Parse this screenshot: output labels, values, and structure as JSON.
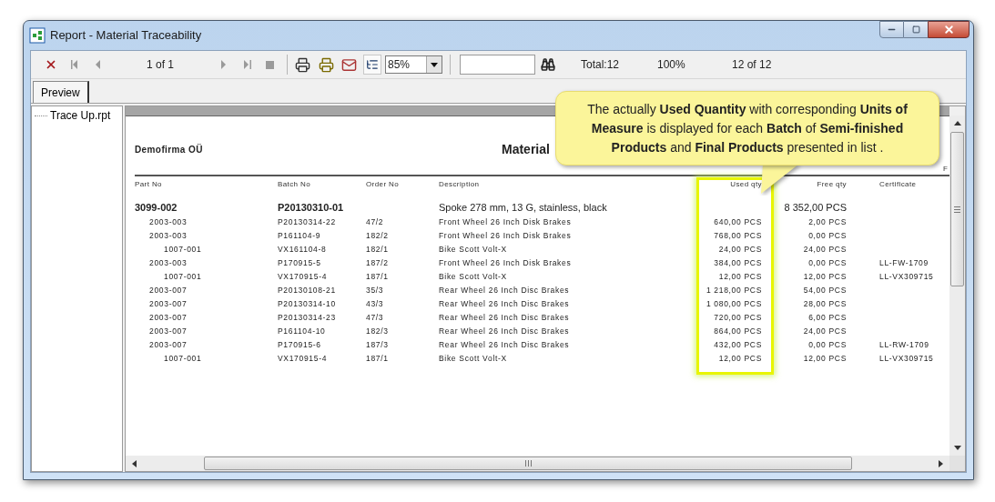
{
  "window": {
    "title": "Report - Material Traceability"
  },
  "toolbar": {
    "page_indicator": "1 of 1",
    "zoom": "85%",
    "tree_toggle": {
      "on": true
    },
    "total": "Total:12",
    "percent": "100%",
    "record_count": "12 of 12"
  },
  "tabs": [
    {
      "label": "Preview",
      "selected": true
    }
  ],
  "tree": {
    "items": [
      {
        "label": "Trace Up.rpt"
      }
    ]
  },
  "report": {
    "company": "Demofirma OÜ",
    "title": "Material",
    "header_cut": "F",
    "columns": [
      {
        "label": "Part No"
      },
      {
        "label": "Batch No"
      },
      {
        "label": "Order No"
      },
      {
        "label": "Description"
      },
      {
        "label": "Used qty"
      },
      {
        "label": "Free qty"
      },
      {
        "label": "Certificate"
      }
    ],
    "used_qty_highlight": {
      "on": true
    },
    "rows": [
      {
        "part_no": "3099-002",
        "batch_no": "P20130310-01",
        "description": "Spoke 278 mm, 13 G, stainless, black",
        "free_qty": "8 352,00 PCS",
        "children": [
          {
            "part_no": "2003-003",
            "batch_no": "P20130314-22",
            "order_no": "47/2",
            "description": "Front Wheel 26 Inch Disk Brakes",
            "used_qty": "640,00 PCS",
            "free_qty": "2,00 PCS"
          },
          {
            "part_no": "2003-003",
            "batch_no": "P161104-9",
            "order_no": "182/2",
            "description": "Front Wheel 26 Inch Disk Brakes",
            "used_qty": "768,00 PCS",
            "free_qty": "0,00 PCS",
            "children": [
              {
                "part_no": "1007-001",
                "batch_no": "VX161104-8",
                "order_no": "182/1",
                "description": "Bike Scott Volt-X",
                "used_qty": "24,00 PCS",
                "free_qty": "24,00 PCS"
              }
            ]
          },
          {
            "part_no": "2003-003",
            "batch_no": "P170915-5",
            "order_no": "187/2",
            "description": "Front Wheel 26 Inch Disk Brakes",
            "used_qty": "384,00 PCS",
            "free_qty": "0,00 PCS",
            "certificate": "LL-FW-1709",
            "children": [
              {
                "part_no": "1007-001",
                "batch_no": "VX170915-4",
                "order_no": "187/1",
                "description": "Bike Scott Volt-X",
                "used_qty": "12,00 PCS",
                "free_qty": "12,00 PCS",
                "certificate": "LL-VX309715"
              }
            ]
          },
          {
            "part_no": "2003-007",
            "batch_no": "P20130108-21",
            "order_no": "35/3",
            "description": "Rear Wheel 26 Inch Disc Brakes",
            "used_qty": "1 218,00 PCS",
            "free_qty": "54,00 PCS"
          },
          {
            "part_no": "2003-007",
            "batch_no": "P20130314-10",
            "order_no": "43/3",
            "description": "Rear Wheel 26 Inch Disc Brakes",
            "used_qty": "1 080,00 PCS",
            "free_qty": "28,00 PCS"
          },
          {
            "part_no": "2003-007",
            "batch_no": "P20130314-23",
            "order_no": "47/3",
            "description": "Rear Wheel 26 Inch Disc Brakes",
            "used_qty": "720,00 PCS",
            "free_qty": "6,00 PCS"
          },
          {
            "part_no": "2003-007",
            "batch_no": "P161104-10",
            "order_no": "182/3",
            "description": "Rear Wheel 26 Inch Disc Brakes",
            "used_qty": "864,00 PCS",
            "free_qty": "24,00 PCS"
          },
          {
            "part_no": "2003-007",
            "batch_no": "P170915-6",
            "order_no": "187/3",
            "description": "Rear Wheel 26 Inch Disc Brakes",
            "used_qty": "432,00 PCS",
            "free_qty": "0,00 PCS",
            "certificate": "LL-RW-1709",
            "children": [
              {
                "part_no": "1007-001",
                "batch_no": "VX170915-4",
                "order_no": "187/1",
                "description": "Bike Scott Volt-X",
                "used_qty": "12,00 PCS",
                "free_qty": "12,00 PCS",
                "certificate": "LL-VX309715"
              }
            ]
          }
        ]
      }
    ]
  },
  "callout": {
    "text": "The actually **Used Quantity** with corresponding **Units of Measure** is displayed for each **Batch** of **Semi-finished Products** and **Final Products** presented in list ."
  }
}
